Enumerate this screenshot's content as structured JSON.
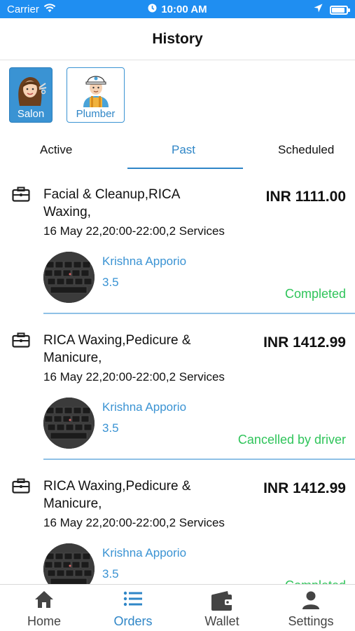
{
  "status_bar": {
    "carrier": "Carrier",
    "time": "10:00 AM",
    "battery_level": 0.9
  },
  "header": {
    "title": "History"
  },
  "categories": [
    {
      "label": "Salon",
      "icon": "salon-woman-icon",
      "selected": true
    },
    {
      "label": "Plumber",
      "icon": "plumber-worker-icon",
      "selected": false
    }
  ],
  "tabs": [
    {
      "label": "Active"
    },
    {
      "label": "Past",
      "selected": true
    },
    {
      "label": "Scheduled"
    }
  ],
  "orders": [
    {
      "services": "Facial & Cleanup,RICA Waxing,",
      "price": "INR 1111.00",
      "datetime": "16 May 22,20:00-22:00,2 Services",
      "driver_name": "Krishna Apporio",
      "rating": "3.5",
      "status": "Completed"
    },
    {
      "services": "RICA Waxing,Pedicure & Manicure,",
      "price": "INR 1412.99",
      "datetime": "16 May 22,20:00-22:00,2 Services",
      "driver_name": "Krishna Apporio",
      "rating": "3.5",
      "status": "Cancelled by driver"
    },
    {
      "services": "RICA Waxing,Pedicure & Manicure,",
      "price": "INR 1412.99",
      "datetime": "16 May 22,20:00-22:00,2 Services",
      "driver_name": "Krishna Apporio",
      "rating": "3.5",
      "status": "Completed"
    }
  ],
  "bottom_nav": [
    {
      "label": "Home",
      "icon": "home-icon"
    },
    {
      "label": "Orders",
      "icon": "list-icon",
      "selected": true
    },
    {
      "label": "Wallet",
      "icon": "wallet-icon"
    },
    {
      "label": "Settings",
      "icon": "person-icon"
    }
  ],
  "colors": {
    "accent": "#2f86c7",
    "status_bar": "#1f8ef1",
    "status_green": "#2fc45a"
  }
}
